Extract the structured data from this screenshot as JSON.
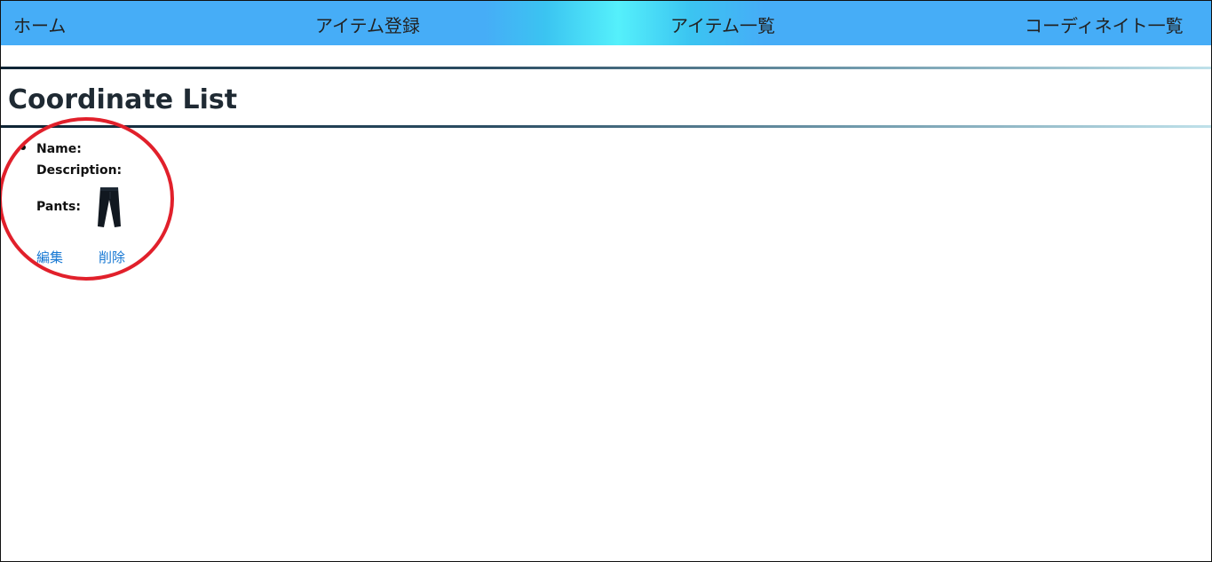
{
  "nav": {
    "home": "ホーム",
    "register_item": "アイテム登録",
    "item_list": "アイテム一覧",
    "coordinate_list": "コーディネイト一覧"
  },
  "page": {
    "title": "Coordinate List"
  },
  "coordinates": [
    {
      "name_label": "Name:",
      "description_label": "Description:",
      "pants_label": "Pants:",
      "pants_image": "pants-thumbnail",
      "edit_label": "編集",
      "delete_label": "削除"
    }
  ],
  "colors": {
    "nav_blue": "#46adf7",
    "nav_highlight": "#55f0fb",
    "link_blue": "#1778d3",
    "annotation_red": "#e1202b"
  }
}
